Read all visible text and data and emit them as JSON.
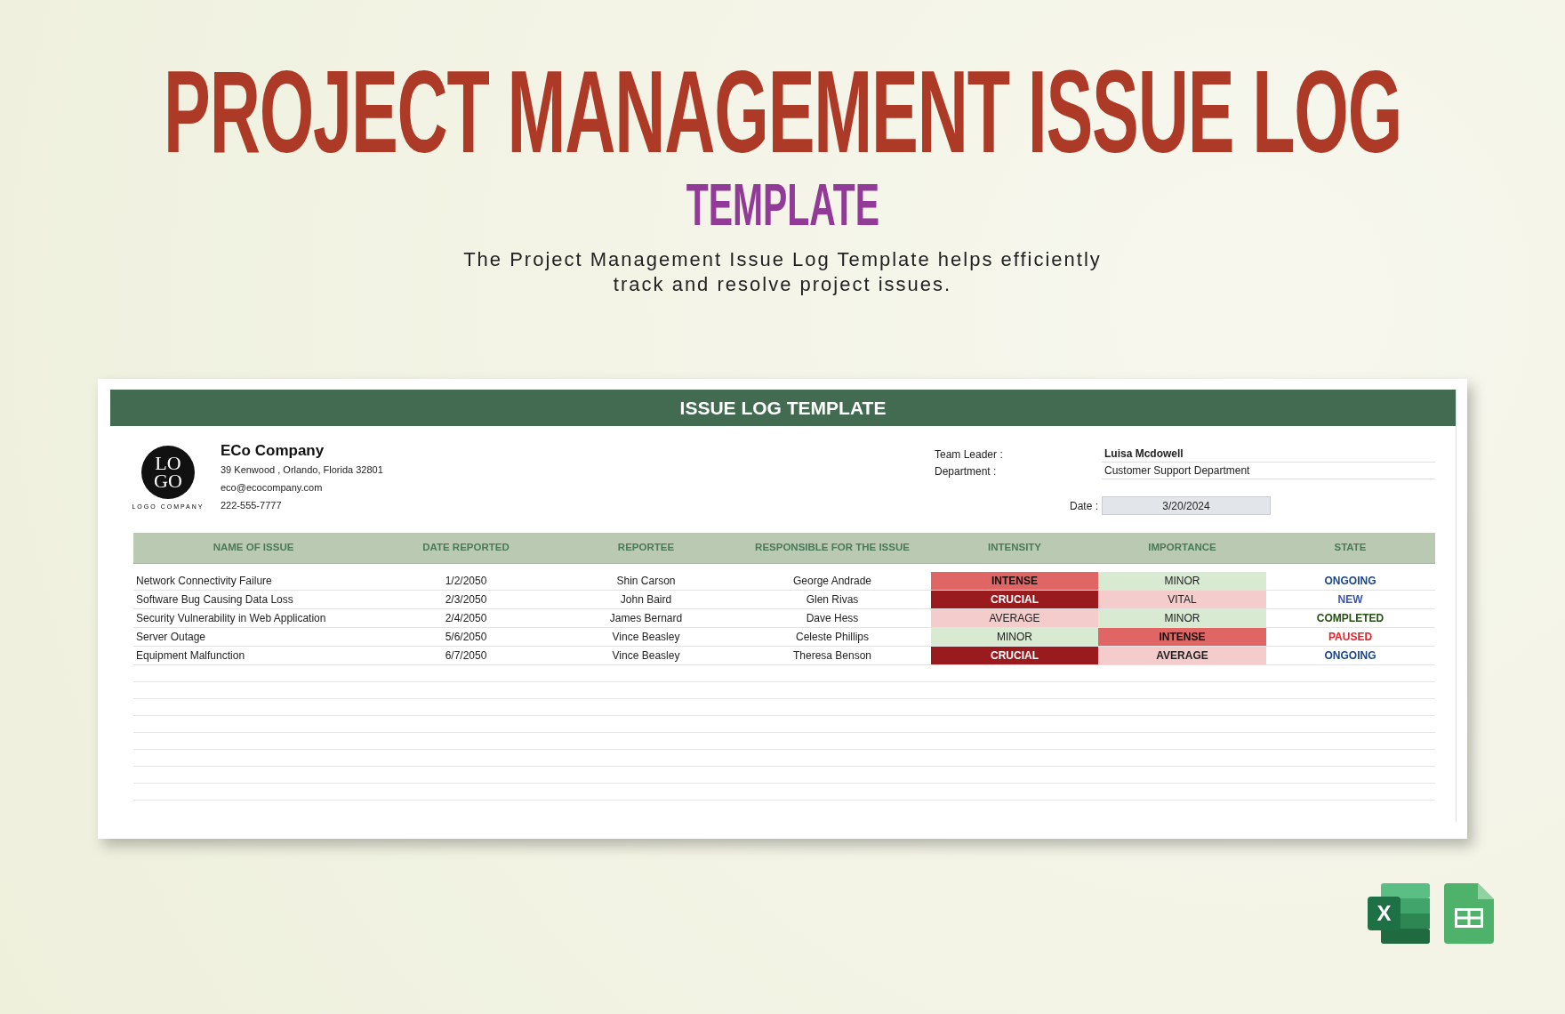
{
  "hero": {
    "title": "PROJECT MANAGEMENT ISSUE LOG",
    "subtitle": "TEMPLATE",
    "description_lines": [
      "The Project Management Issue Log Template helps efficiently",
      "track and resolve project issues."
    ]
  },
  "sheet": {
    "banner": "ISSUE LOG TEMPLATE",
    "company": {
      "logo_top": "LO",
      "logo_bottom": "GO",
      "logo_caption": "LOGO COMPANY",
      "name": "ECo Company",
      "address": "39 Kenwood , Orlando, Florida 32801",
      "email": "eco@ecocompany.com",
      "phone": "222-555-7777"
    },
    "info": [
      {
        "label": "Team Leader  :",
        "value": "Luisa Mcdowell",
        "bold": true
      },
      {
        "label": "Department  :",
        "value": "Customer  Support Department",
        "bold": false
      }
    ],
    "date": {
      "label": "Date   :",
      "value": "3/20/2024"
    },
    "columns": [
      "NAME OF ISSUE",
      "DATE REPORTED",
      "REPORTEE",
      "RESPONSIBLE FOR THE ISSUE",
      "INTENSITY",
      "IMPORTANCE",
      "STATE"
    ],
    "rows": [
      {
        "name": "Network Connectivity Failure",
        "date": "1/2/2050",
        "reportee": "Shin Carson",
        "responsible": "George Andrade",
        "intensity": {
          "text": "INTENSE",
          "kind": "intense",
          "bold": true
        },
        "importance": {
          "text": "MINOR",
          "kind": "minor",
          "bold": false
        },
        "state": {
          "text": "ONGOING",
          "color": "#1c4587"
        }
      },
      {
        "name": "Software Bug Causing Data Loss",
        "date": "2/3/2050",
        "reportee": "John Baird",
        "responsible": "Glen Rivas",
        "intensity": {
          "text": "CRUCIAL",
          "kind": "crucial",
          "bold": true
        },
        "importance": {
          "text": "VITAL",
          "kind": "average",
          "bold": false
        },
        "state": {
          "text": "NEW",
          "color": "#3c56b0"
        }
      },
      {
        "name": "Security Vulnerability in Web Application",
        "date": "2/4/2050",
        "reportee": "James Bernard",
        "responsible": "Dave Hess",
        "intensity": {
          "text": "AVERAGE",
          "kind": "average",
          "bold": false
        },
        "importance": {
          "text": "MINOR",
          "kind": "minor",
          "bold": false
        },
        "state": {
          "text": "COMPLETED",
          "color": "#274e13"
        }
      },
      {
        "name": "Server Outage",
        "date": "5/6/2050",
        "reportee": "Vince Beasley",
        "responsible": "Celeste Phillips",
        "intensity": {
          "text": "MINOR",
          "kind": "minor",
          "bold": false
        },
        "importance": {
          "text": "INTENSE",
          "kind": "intense",
          "bold": true
        },
        "state": {
          "text": "PAUSED",
          "color": "#e8222a"
        }
      },
      {
        "name": "Equipment Malfunction",
        "date": "6/7/2050",
        "reportee": "Vince Beasley",
        "responsible": "Theresa Benson",
        "intensity": {
          "text": "CRUCIAL",
          "kind": "crucial",
          "bold": true
        },
        "importance": {
          "text": "AVERAGE",
          "kind": "average",
          "bold": true
        },
        "state": {
          "text": "ONGOING",
          "color": "#1c4587"
        }
      }
    ]
  },
  "apps": [
    {
      "kind": "excel",
      "letter": "X"
    },
    {
      "kind": "sheets"
    }
  ]
}
